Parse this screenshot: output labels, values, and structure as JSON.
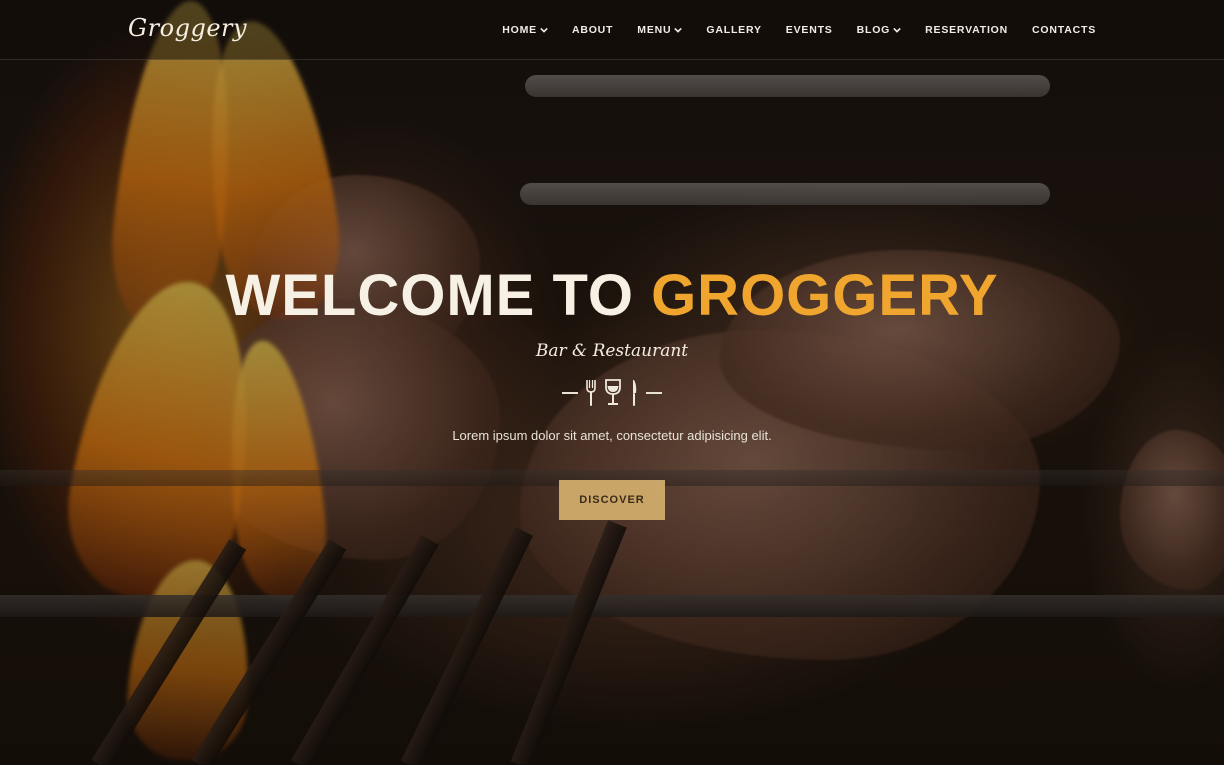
{
  "brand": {
    "logo": "Groggery"
  },
  "nav": {
    "items": [
      {
        "label": "HOME",
        "dropdown": true
      },
      {
        "label": "ABOUT",
        "dropdown": false
      },
      {
        "label": "MENU",
        "dropdown": true
      },
      {
        "label": "GALLERY",
        "dropdown": false
      },
      {
        "label": "EVENTS",
        "dropdown": false
      },
      {
        "label": "BLOG",
        "dropdown": true
      },
      {
        "label": "RESERVATION",
        "dropdown": false
      },
      {
        "label": "CONTACTS",
        "dropdown": false
      }
    ]
  },
  "hero": {
    "title_prefix": "WELCOME TO ",
    "title_accent": "GROGGERY",
    "subtitle": "Bar & Restaurant",
    "divider_icons": [
      "fork-icon",
      "wine-glass-icon",
      "knife-icon"
    ],
    "lead": "Lorem ipsum dolor sit amet, consectetur adipisicing elit.",
    "cta_label": "DISCOVER"
  },
  "colors": {
    "accent": "#f0a62e",
    "button_bg": "#d4b06e",
    "text_light": "#f6f1e4"
  }
}
